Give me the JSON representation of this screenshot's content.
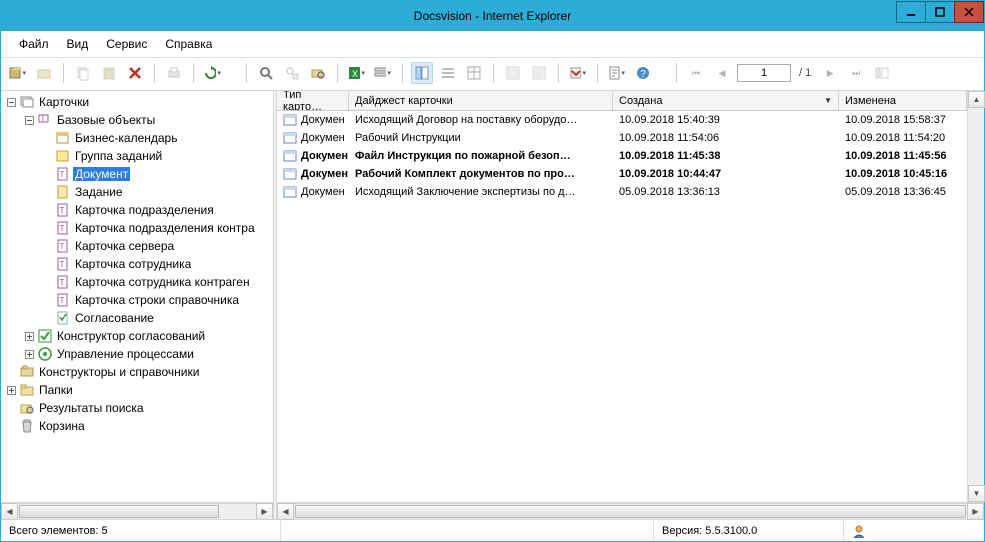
{
  "window": {
    "title": "Docsvision - Internet Explorer"
  },
  "menu": {
    "file": "Файл",
    "view": "Вид",
    "service": "Сервис",
    "help": "Справка"
  },
  "toolbar": {
    "pager": {
      "current": "1",
      "total": "/ 1"
    }
  },
  "tree": {
    "root": "Карточки",
    "base_objects": "Базовые объекты",
    "items": {
      "biz_calendar": "Бизнес-календарь",
      "task_group": "Группа заданий",
      "document": "Документ",
      "task": "Задание",
      "unit_card": "Карточка подразделения",
      "unit_card_contra": "Карточка подразделения контра",
      "server_card": "Карточка сервера",
      "employee_card": "Карточка сотрудника",
      "employee_card_contragent": "Карточка сотрудника контраген",
      "ref_row_card": "Карточка строки справочника",
      "approval": "Согласование"
    },
    "approval_designer": "Конструктор согласований",
    "process_mgmt": "Управление процессами",
    "ref_designers": "Конструкторы и справочники",
    "folders": "Папки",
    "search_results": "Результаты поиска",
    "recycle": "Корзина"
  },
  "grid": {
    "columns": {
      "type": "Тип карто…",
      "digest": "Дайджест карточки",
      "created": "Создана",
      "modified": "Изменена"
    },
    "rows": [
      {
        "bold": false,
        "type": "Докумен",
        "digest": "Исходящий Договор на поставку оборудо…",
        "created": "10.09.2018 15:40:39",
        "modified": "10.09.2018 15:58:37"
      },
      {
        "bold": false,
        "type": "Докумен",
        "digest": "Рабочий Инструкции",
        "created": "10.09.2018 11:54:06",
        "modified": "10.09.2018 11:54:20"
      },
      {
        "bold": true,
        "type": "Докумен",
        "digest": "Файл Инструкция по пожарной безоп…",
        "created": "10.09.2018 11:45:38",
        "modified": "10.09.2018 11:45:56"
      },
      {
        "bold": true,
        "type": "Докумен",
        "digest": "Рабочий Комплект документов по про…",
        "created": "10.09.2018 10:44:47",
        "modified": "10.09.2018 10:45:16"
      },
      {
        "bold": false,
        "type": "Докумен",
        "digest": "Исходящий Заключение экспертизы по д…",
        "created": "05.09.2018 13:36:13",
        "modified": "05.09.2018 13:36:45"
      }
    ]
  },
  "status": {
    "count_label": "Всего элементов: 5",
    "version_label": "Версия: 5.5.3100.0"
  }
}
